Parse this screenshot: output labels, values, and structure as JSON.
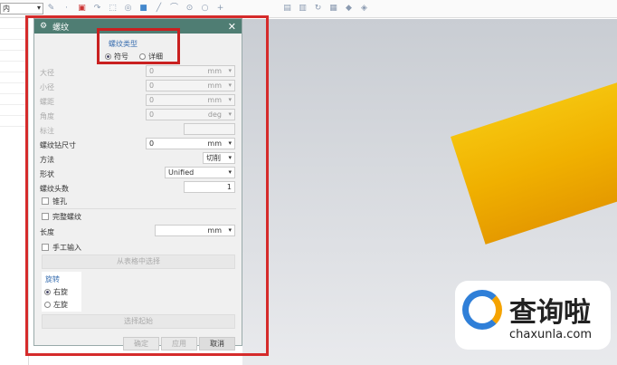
{
  "toolbar": {
    "combo_value": "内",
    "icons": [
      "sketch",
      "point",
      "line",
      "arc",
      "rect",
      "circle",
      "plus",
      "view",
      "render",
      "shade",
      "layer"
    ]
  },
  "dialog": {
    "title": "螺纹",
    "thread_type": {
      "label": "螺纹类型",
      "options": [
        "符号",
        "详细"
      ],
      "selected": "符号"
    },
    "major_diameter": {
      "label": "大径",
      "value": "0",
      "unit": "mm"
    },
    "minor_diameter": {
      "label": "小径",
      "value": "0",
      "unit": "mm"
    },
    "pitch": {
      "label": "螺距",
      "value": "0",
      "unit": "mm"
    },
    "angle": {
      "label": "角度",
      "value": "0",
      "unit": "deg"
    },
    "callout": {
      "label": "标注"
    },
    "tap_drill": {
      "label": "螺纹钻尺寸",
      "value": "0",
      "unit": "mm"
    },
    "method": {
      "label": "方法",
      "value": "切削"
    },
    "form": {
      "label": "形状",
      "value": "Unified"
    },
    "starts": {
      "label": "螺纹头数",
      "value": "1"
    },
    "tapered": {
      "label": "锥孔"
    },
    "full_thread": {
      "label": "完整螺纹"
    },
    "length": {
      "label": "长度",
      "unit": "mm"
    },
    "manual_input": {
      "label": "手工输入"
    },
    "choose_from_table": "从表格中选择",
    "rotation": {
      "label": "旋转",
      "options": [
        "右旋",
        "左旋"
      ],
      "selected": "右旋"
    },
    "select_start": "选择起始",
    "ok": "确定",
    "apply": "应用",
    "cancel": "取消"
  },
  "watermark": {
    "brand": "查询啦",
    "url": "chaxunla.com"
  }
}
